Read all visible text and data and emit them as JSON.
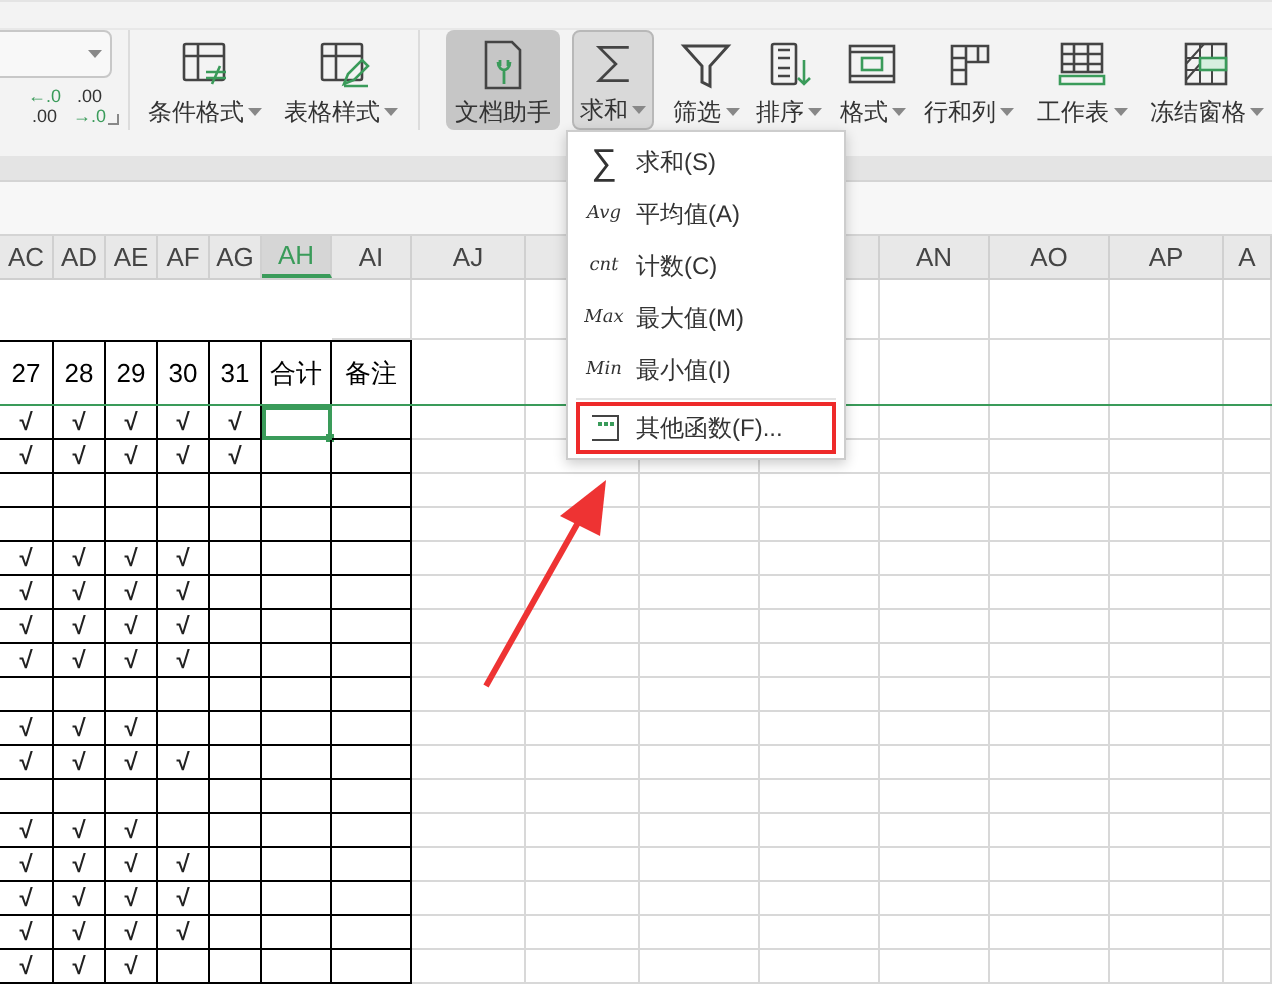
{
  "toolbar": {
    "decimal_buttons": [
      {
        "top": "←.0",
        "bottom": ".00"
      },
      {
        "top": ".00",
        "bottom": "→.0"
      }
    ],
    "buttons": [
      {
        "kind": "cond",
        "label": "条件格式",
        "dropdown": true,
        "selected": false
      },
      {
        "kind": "tablestyle",
        "label": "表格样式",
        "dropdown": true,
        "selected": false
      },
      {
        "kind": "helper",
        "label": "文档助手",
        "dropdown": false,
        "selected": true
      },
      {
        "kind": "sum",
        "label": "求和",
        "dropdown": true,
        "selected": true
      },
      {
        "kind": "filter",
        "label": "筛选",
        "dropdown": true,
        "selected": false
      },
      {
        "kind": "sort",
        "label": "排序",
        "dropdown": true,
        "selected": false
      },
      {
        "kind": "format",
        "label": "格式",
        "dropdown": true,
        "selected": false
      },
      {
        "kind": "rowcol",
        "label": "行和列",
        "dropdown": true,
        "selected": false
      },
      {
        "kind": "sheet",
        "label": "工作表",
        "dropdown": true,
        "selected": false
      },
      {
        "kind": "freeze",
        "label": "冻结窗格",
        "dropdown": true,
        "selected": false
      }
    ]
  },
  "columns": [
    {
      "label": "AC",
      "selected": false
    },
    {
      "label": "AD",
      "selected": false
    },
    {
      "label": "AE",
      "selected": false
    },
    {
      "label": "AF",
      "selected": false
    },
    {
      "label": "AG",
      "selected": false
    },
    {
      "label": "AH",
      "selected": true
    },
    {
      "label": "AI",
      "selected": false
    },
    {
      "label": "AJ",
      "selected": false
    },
    {
      "label": "AN",
      "selected": false
    },
    {
      "label": "AO",
      "selected": false
    },
    {
      "label": "AP",
      "selected": false
    },
    {
      "label": "A",
      "selected": false
    }
  ],
  "table": {
    "headers": [
      "27",
      "28",
      "29",
      "30",
      "31",
      "合计",
      "备注"
    ],
    "rows": [
      {
        "marks": [
          "√",
          "√",
          "√",
          "√",
          "√"
        ],
        "selected": true
      },
      {
        "marks": [
          "√",
          "√",
          "√",
          "√",
          "√"
        ],
        "selected": false
      },
      {
        "marks": [],
        "selected": false
      },
      {
        "marks": [],
        "selected": false
      },
      {
        "marks": [
          "√",
          "√",
          "√",
          "√"
        ],
        "selected": false
      },
      {
        "marks": [
          "√",
          "√",
          "√",
          "√"
        ],
        "selected": false
      },
      {
        "marks": [
          "√",
          "√",
          "√",
          "√"
        ],
        "selected": false
      },
      {
        "marks": [
          "√",
          "√",
          "√",
          "√"
        ],
        "selected": false
      },
      {
        "marks": [],
        "selected": false
      },
      {
        "marks": [
          "√",
          "√",
          "√"
        ],
        "selected": false
      },
      {
        "marks": [
          "√",
          "√",
          "√",
          "√"
        ],
        "selected": false
      },
      {
        "marks": [],
        "selected": false
      },
      {
        "marks": [
          "√",
          "√",
          "√"
        ],
        "selected": false
      },
      {
        "marks": [
          "√",
          "√",
          "√",
          "√"
        ],
        "selected": false
      },
      {
        "marks": [
          "√",
          "√",
          "√",
          "√"
        ],
        "selected": false
      },
      {
        "marks": [
          "√",
          "√",
          "√",
          "√"
        ],
        "selected": false
      },
      {
        "marks": [
          "√",
          "√",
          "√"
        ],
        "selected": false
      }
    ]
  },
  "menu": {
    "items": [
      {
        "kind": "sigma",
        "icon_text": "∑",
        "label": "求和(S)",
        "highlighted": false
      },
      {
        "kind": "abbr",
        "icon_text": "Avg",
        "label": "平均值(A)",
        "highlighted": false
      },
      {
        "kind": "abbr",
        "icon_text": "cnt",
        "label": "计数(C)",
        "highlighted": false
      },
      {
        "kind": "abbr",
        "icon_text": "Max",
        "label": "最大值(M)",
        "highlighted": false
      },
      {
        "kind": "abbr",
        "icon_text": "Min",
        "label": "最小值(I)",
        "highlighted": false
      },
      {
        "kind": "more",
        "label": "其他函数(F)...",
        "highlighted": true
      }
    ]
  }
}
